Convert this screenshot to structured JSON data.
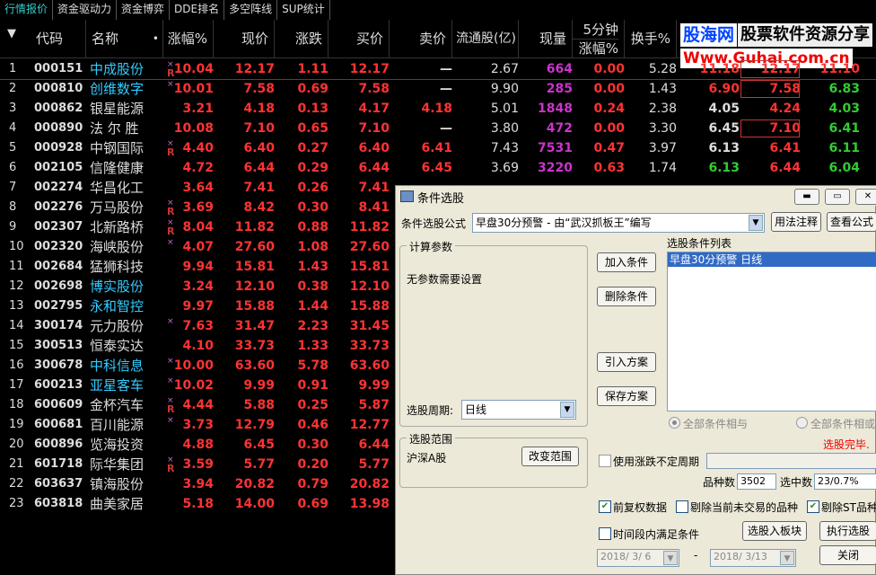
{
  "tabs": [
    "行情报价",
    "资金驱动力",
    "资金博弈",
    "DDE排名",
    "多空阵线",
    "SUP统计"
  ],
  "header": {
    "sort_arrow": "▼",
    "cols": [
      "代码",
      "名称",
      "涨幅%",
      "现价",
      "涨跌",
      "买价",
      "卖价",
      "流通股(亿)",
      "现量",
      "5分钟",
      "涨幅%",
      "换手%"
    ],
    "name_dot": "•"
  },
  "watermark": {
    "line1a": "股海网",
    "line1b": "股票软件资源分享",
    "line2": "Www.Guhai.com.cn"
  },
  "rows": [
    {
      "n": "1",
      "code": "000151",
      "name": "中成股份",
      "mk": "×",
      "mk2": "R",
      "zf": "10.04",
      "xj": "12.17",
      "zd": "1.11",
      "mj": "12.17",
      "mc": "—",
      "lt": "2.67",
      "xl": "664",
      "fz": "0.00",
      "hs": "5.28",
      "e1": "11.18",
      "e2": "12.17",
      "e3": "11.10"
    },
    {
      "n": "2",
      "code": "000810",
      "name": "创维数字",
      "mk": "×",
      "mk2": "",
      "zf": "10.01",
      "xj": "7.58",
      "zd": "0.69",
      "mj": "7.58",
      "mc": "—",
      "lt": "9.90",
      "xl": "285",
      "fz": "0.00",
      "hs": "1.43",
      "e1": "6.90",
      "e2": "7.58",
      "e3": "6.83"
    },
    {
      "n": "3",
      "code": "000862",
      "name": "银星能源",
      "mk": "",
      "mk2": "",
      "zf": "3.21",
      "xj": "4.18",
      "zd": "0.13",
      "mj": "4.17",
      "mc": "4.18",
      "lt": "5.01",
      "xl": "1848",
      "fz": "0.24",
      "hs": "2.38",
      "e1": "4.05",
      "e2": "4.24",
      "e3": "4.03"
    },
    {
      "n": "4",
      "code": "000890",
      "name": "法 尔 胜",
      "mk": "",
      "mk2": "",
      "zf": "10.08",
      "xj": "7.10",
      "zd": "0.65",
      "mj": "7.10",
      "mc": "—",
      "lt": "3.80",
      "xl": "472",
      "fz": "0.00",
      "hs": "3.30",
      "e1": "6.45",
      "e2": "7.10",
      "e3": "6.41"
    },
    {
      "n": "5",
      "code": "000928",
      "name": "中钢国际",
      "mk": "×",
      "mk2": "R",
      "zf": "4.40",
      "xj": "6.40",
      "zd": "0.27",
      "mj": "6.40",
      "mc": "6.41",
      "lt": "7.43",
      "xl": "7531",
      "fz": "0.47",
      "hs": "3.97",
      "e1": "6.13",
      "e2": "6.41",
      "e3": "6.11"
    },
    {
      "n": "6",
      "code": "002105",
      "name": "信隆健康",
      "mk": "",
      "mk2": "",
      "zf": "4.72",
      "xj": "6.44",
      "zd": "0.29",
      "mj": "6.44",
      "mc": "6.45",
      "lt": "3.69",
      "xl": "3220",
      "fz": "0.63",
      "hs": "1.74",
      "e1": "6.13",
      "e2": "6.44",
      "e3": "6.04"
    },
    {
      "n": "7",
      "code": "002274",
      "name": "华昌化工",
      "mk": "",
      "mk2": "",
      "zf": "3.64",
      "xj": "7.41",
      "zd": "0.26",
      "mj": "7.41",
      "mc": "",
      "lt": "",
      "xl": "",
      "fz": "",
      "hs": "",
      "e1": "",
      "e2": "",
      "e3": ""
    },
    {
      "n": "8",
      "code": "002276",
      "name": "万马股份",
      "mk": "×",
      "mk2": "R",
      "zf": "3.69",
      "xj": "8.42",
      "zd": "0.30",
      "mj": "8.41",
      "mc": "",
      "lt": "",
      "xl": "",
      "fz": "",
      "hs": "",
      "e1": "",
      "e2": "",
      "e3": ""
    },
    {
      "n": "9",
      "code": "002307",
      "name": "北新路桥",
      "mk": "×",
      "mk2": "R",
      "zf": "8.04",
      "xj": "11.82",
      "zd": "0.88",
      "mj": "11.82",
      "mc": "",
      "lt": "",
      "xl": "",
      "fz": "",
      "hs": "",
      "e1": "",
      "e2": "",
      "e3": ""
    },
    {
      "n": "10",
      "code": "002320",
      "name": "海峡股份",
      "mk": "×",
      "mk2": "",
      "zf": "4.07",
      "xj": "27.60",
      "zd": "1.08",
      "mj": "27.60",
      "mc": "",
      "lt": "",
      "xl": "",
      "fz": "",
      "hs": "",
      "e1": "",
      "e2": "",
      "e3": ""
    },
    {
      "n": "11",
      "code": "002684",
      "name": "猛狮科技",
      "mk": "",
      "mk2": "",
      "zf": "9.94",
      "xj": "15.81",
      "zd": "1.43",
      "mj": "15.81",
      "mc": "",
      "lt": "",
      "xl": "",
      "fz": "",
      "hs": "",
      "e1": "",
      "e2": "",
      "e3": ""
    },
    {
      "n": "12",
      "code": "002698",
      "name": "博实股份",
      "mk": "",
      "mk2": "",
      "zf": "3.24",
      "xj": "12.10",
      "zd": "0.38",
      "mj": "12.10",
      "mc": "",
      "lt": "",
      "xl": "",
      "fz": "",
      "hs": "",
      "e1": "",
      "e2": "",
      "e3": ""
    },
    {
      "n": "13",
      "code": "002795",
      "name": "永和智控",
      "mk": "",
      "mk2": "",
      "zf": "9.97",
      "xj": "15.88",
      "zd": "1.44",
      "mj": "15.88",
      "mc": "",
      "lt": "",
      "xl": "",
      "fz": "",
      "hs": "",
      "e1": "",
      "e2": "",
      "e3": ""
    },
    {
      "n": "14",
      "code": "300174",
      "name": "元力股份",
      "mk": "×",
      "mk2": "",
      "zf": "7.63",
      "xj": "31.47",
      "zd": "2.23",
      "mj": "31.45",
      "mc": "",
      "lt": "",
      "xl": "",
      "fz": "",
      "hs": "",
      "e1": "",
      "e2": "",
      "e3": ""
    },
    {
      "n": "15",
      "code": "300513",
      "name": "恒泰实达",
      "mk": "",
      "mk2": "",
      "zf": "4.10",
      "xj": "33.73",
      "zd": "1.33",
      "mj": "33.73",
      "mc": "",
      "lt": "",
      "xl": "",
      "fz": "",
      "hs": "",
      "e1": "",
      "e2": "",
      "e3": ""
    },
    {
      "n": "16",
      "code": "300678",
      "name": "中科信息",
      "mk": "×",
      "mk2": "",
      "zf": "10.00",
      "xj": "63.60",
      "zd": "5.78",
      "mj": "63.60",
      "mc": "",
      "lt": "",
      "xl": "",
      "fz": "",
      "hs": "",
      "e1": "",
      "e2": "",
      "e3": ""
    },
    {
      "n": "17",
      "code": "600213",
      "name": "亚星客车",
      "mk": "×",
      "mk2": "",
      "zf": "10.02",
      "xj": "9.99",
      "zd": "0.91",
      "mj": "9.99",
      "mc": "",
      "lt": "",
      "xl": "",
      "fz": "",
      "hs": "",
      "e1": "",
      "e2": "",
      "e3": ""
    },
    {
      "n": "18",
      "code": "600609",
      "name": "金杯汽车",
      "mk": "×",
      "mk2": "R",
      "zf": "4.44",
      "xj": "5.88",
      "zd": "0.25",
      "mj": "5.87",
      "mc": "",
      "lt": "",
      "xl": "",
      "fz": "",
      "hs": "",
      "e1": "",
      "e2": "",
      "e3": ""
    },
    {
      "n": "19",
      "code": "600681",
      "name": "百川能源",
      "mk": "×",
      "mk2": "",
      "zf": "3.73",
      "xj": "12.79",
      "zd": "0.46",
      "mj": "12.77",
      "mc": "",
      "lt": "",
      "xl": "",
      "fz": "",
      "hs": "",
      "e1": "",
      "e2": "",
      "e3": ""
    },
    {
      "n": "20",
      "code": "600896",
      "name": "览海投资",
      "mk": "",
      "mk2": "",
      "zf": "4.88",
      "xj": "6.45",
      "zd": "0.30",
      "mj": "6.44",
      "mc": "",
      "lt": "",
      "xl": "",
      "fz": "",
      "hs": "",
      "e1": "",
      "e2": "",
      "e3": ""
    },
    {
      "n": "21",
      "code": "601718",
      "name": "际华集团",
      "mk": "×",
      "mk2": "R",
      "zf": "3.59",
      "xj": "5.77",
      "zd": "0.20",
      "mj": "5.77",
      "mc": "",
      "lt": "",
      "xl": "",
      "fz": "",
      "hs": "",
      "e1": "",
      "e2": "",
      "e3": ""
    },
    {
      "n": "22",
      "code": "603637",
      "name": "镇海股份",
      "mk": "",
      "mk2": "",
      "zf": "3.94",
      "xj": "20.82",
      "zd": "0.79",
      "mj": "20.82",
      "mc": "",
      "lt": "",
      "xl": "",
      "fz": "",
      "hs": "",
      "e1": "",
      "e2": "",
      "e3": ""
    },
    {
      "n": "23",
      "code": "603818",
      "name": "曲美家居",
      "mk": "",
      "mk2": "",
      "zf": "5.18",
      "xj": "14.00",
      "zd": "0.69",
      "mj": "13.98",
      "mc": "",
      "lt": "",
      "xl": "",
      "fz": "",
      "hs": "",
      "e1": "",
      "e2": "",
      "e3": ""
    }
  ],
  "dialog": {
    "title": "条件选股",
    "formula_label": "条件选股公式",
    "formula_value": "早盘30分预警 - 由“武汉抓板王”编写",
    "usage_btn": "用法注释",
    "view_formula_btn": "查看公式",
    "params_group": "计算参数",
    "no_params": "无参数需要设置",
    "add_cond": "加入条件",
    "del_cond": "删除条件",
    "import_plan": "引入方案",
    "save_plan": "保存方案",
    "list_label": "选股条件列表",
    "list_item": "早盘30分预警   日线",
    "radio_and": "全部条件相与",
    "radio_or": "全部条件相或",
    "done_text": "选股完毕.",
    "period_label": "选股周期:",
    "period_value": "日线",
    "range_group": "选股范围",
    "range_value": "沪深A股",
    "change_range": "改变范围",
    "use_var_period": "使用涨跌不定周期",
    "count_label": "品种数",
    "count_value": "3502",
    "hit_label": "选中数",
    "hit_value": "23/0.7%",
    "fq": "前复权数据",
    "exclude_untraded": "剔除当前未交易的品种",
    "exclude_st": "剔除ST品种",
    "time_cond": "时间段内满足条件",
    "to_block": "选股入板块",
    "exec": "执行选股",
    "close": "关闭",
    "date_from": "2018/ 3/ 6",
    "date_to": "2018/ 3/13",
    "dash": "-"
  }
}
